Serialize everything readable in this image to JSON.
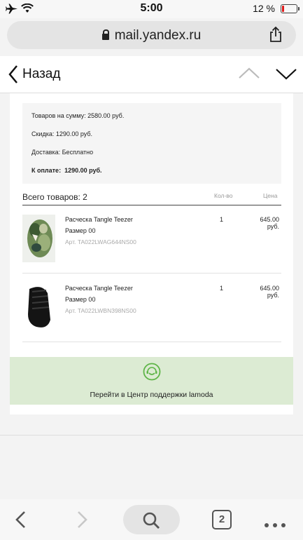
{
  "status_bar": {
    "time": "5:00",
    "battery_text": "12 %"
  },
  "browser": {
    "url": "mail.yandex.ru"
  },
  "nav": {
    "back_label": "Назад"
  },
  "order_summary": {
    "goods_total": "Товаров на сумму: 2580.00 руб.",
    "discount": "Скидка:  1290.00 руб.",
    "delivery": "Доставка:  Бесплатно",
    "to_pay_label": "К оплате:",
    "to_pay_value": "1290.00 руб."
  },
  "items_header": {
    "total": "Всего товаров: 2",
    "qty_header": "Кол-во",
    "price_header": "Цена"
  },
  "items": [
    {
      "name": "Расческа Tangle Teezer",
      "size": "Размер 00",
      "article": "Арт. TA022LWAG644NS00",
      "qty": "1",
      "price": "645.00 руб."
    },
    {
      "name": "Расческа Tangle Teezer",
      "size": "Размер 00",
      "article": "Арт. TA022LWBN398NS00",
      "qty": "1",
      "price": "645.00 руб."
    }
  ],
  "support": {
    "label": "Перейти в Центр поддержки lamoda"
  },
  "toolbar": {
    "tab_count": "2"
  },
  "colors": {
    "support_bg": "#dcebd3",
    "support_icon": "#5fb548",
    "battery_low": "#e01b1b"
  }
}
